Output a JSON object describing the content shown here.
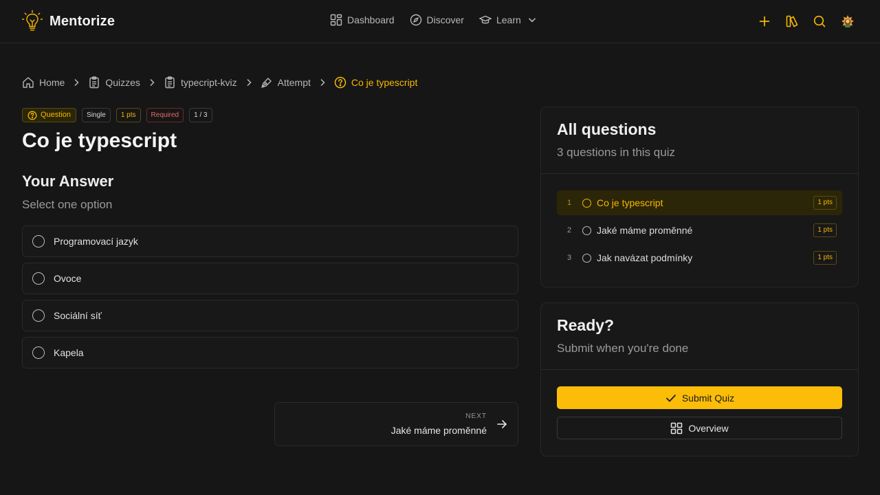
{
  "app": {
    "name": "Mentorize"
  },
  "nav": {
    "items": [
      {
        "label": "Dashboard",
        "icon": "dashboard-icon"
      },
      {
        "label": "Discover",
        "icon": "compass-icon"
      },
      {
        "label": "Learn",
        "icon": "graduation-cap-icon"
      }
    ]
  },
  "header_actions": [
    "plus-icon",
    "library-icon",
    "search-icon",
    "user-avatar"
  ],
  "breadcrumb": [
    {
      "label": "Home",
      "icon": "home-icon"
    },
    {
      "label": "Quizzes",
      "icon": "clipboard-icon"
    },
    {
      "label": "typecript-kviz",
      "icon": "clipboard-icon"
    },
    {
      "label": "Attempt",
      "icon": "pen-icon"
    },
    {
      "label": "Co je typescript",
      "icon": "question-circle-icon"
    }
  ],
  "question": {
    "badges": {
      "type": "Question",
      "mode": "Single",
      "points": "1 pts",
      "required": "Required",
      "position": "1 / 3"
    },
    "title": "Co je typescript"
  },
  "answer": {
    "title": "Your Answer",
    "subtitle": "Select one option",
    "options": [
      "Programovací jazyk",
      "Ovoce",
      "Sociální síť",
      "Kapela"
    ]
  },
  "next": {
    "eyebrow": "NEXT",
    "label": "Jaké máme proměnné"
  },
  "all_questions": {
    "title": "All questions",
    "subtitle": "3 questions in this quiz",
    "items": [
      {
        "num": "1",
        "label": "Co je typescript",
        "points": "1 pts",
        "active": true
      },
      {
        "num": "2",
        "label": "Jaké máme proměnné",
        "points": "1 pts",
        "active": false
      },
      {
        "num": "3",
        "label": "Jak navázat podmínky",
        "points": "1 pts",
        "active": false
      }
    ]
  },
  "ready": {
    "title": "Ready?",
    "subtitle": "Submit when you're done",
    "submit_label": "Submit Quiz",
    "overview_label": "Overview"
  },
  "colors": {
    "background": "#161616",
    "accent": "#f5b800",
    "submit_bg": "#fbbd08",
    "required": "#e26a6a"
  }
}
